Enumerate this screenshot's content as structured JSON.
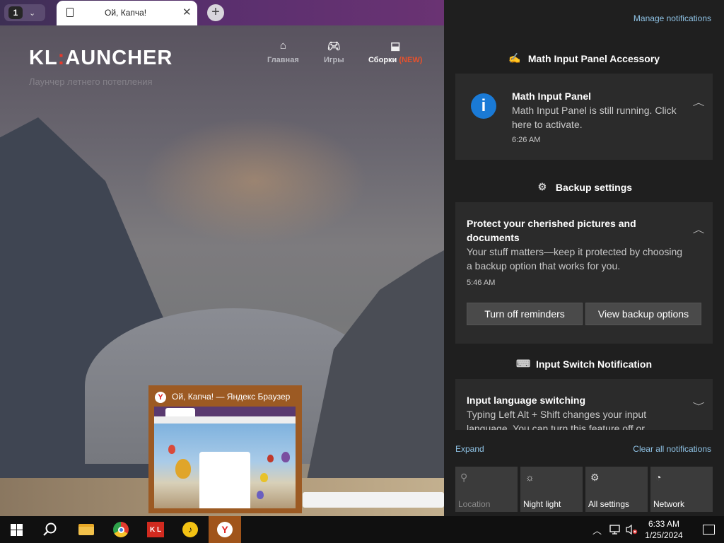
{
  "browser": {
    "tab_count": "1",
    "tab_title": "Ой, Капча!",
    "tab_close": "✕",
    "new_tab": "+"
  },
  "site": {
    "logo_prefix": "KL",
    "logo_colon": ":",
    "logo_suffix": "AUNCHER",
    "subtitle": "Лаунчер летнего потепления",
    "nav": {
      "home": "Главная",
      "games": "Игры",
      "builds": "Сборки",
      "builds_badge": "(NEW)"
    }
  },
  "thumbnail": {
    "title": "Ой, Капча! — Яндекс Браузер",
    "icon_letter": "Y"
  },
  "action_center": {
    "manage_link": "Manage notifications",
    "groups": [
      {
        "app": "Math Input Panel Accessory",
        "title": "Math Input Panel",
        "body": "Math Input Panel is still running. Click here to activate.",
        "time": "6:26 AM"
      },
      {
        "app": "Backup settings",
        "title": "Protect your cherished pictures and documents",
        "body": "Your stuff matters—keep it protected by choosing a backup option that works for you.",
        "time": "5:46 AM",
        "actions": [
          "Turn off reminders",
          "View backup options"
        ]
      },
      {
        "app": "Input Switch Notification",
        "title": "Input language switching",
        "body": "Typing Left Alt + Shift changes your input language. You can turn this feature off or"
      }
    ],
    "expand": "Expand",
    "clear_all": "Clear all notifications",
    "quick_actions": [
      {
        "label": "Location",
        "icon": "location-icon",
        "enabled": false
      },
      {
        "label": "Night light",
        "icon": "night-light-icon",
        "enabled": true
      },
      {
        "label": "All settings",
        "icon": "gear-icon",
        "enabled": true
      },
      {
        "label": "Network",
        "icon": "network-icon",
        "enabled": true
      }
    ]
  },
  "taskbar": {
    "time": "6:33 AM",
    "date": "1/25/2024",
    "apps": [
      "start",
      "search",
      "file-explorer",
      "chrome",
      "kl-launcher",
      "yandex-music",
      "yandex-browser"
    ],
    "active_app": "yandex-browser"
  },
  "colors": {
    "accent_link": "#8fc3e6",
    "logo_accent": "#e83a2c",
    "active_taskbar": "#a0541a",
    "info_blue": "#1a7ad6"
  }
}
